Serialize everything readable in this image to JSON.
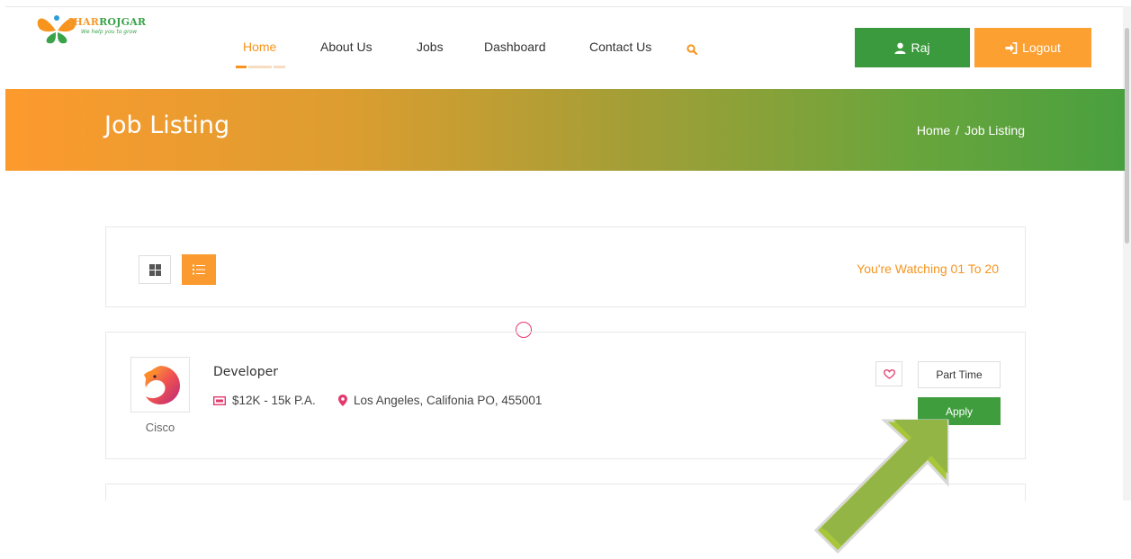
{
  "header": {
    "logo": {
      "part1": "JHAR",
      "part2": "ROJGAR",
      "tagline": "We help you to grow"
    },
    "nav": [
      {
        "label": "Home",
        "active": true
      },
      {
        "label": "About Us",
        "active": false
      },
      {
        "label": "Jobs",
        "active": false
      },
      {
        "label": "Dashboard",
        "active": false
      },
      {
        "label": "Contact Us",
        "active": false
      }
    ],
    "search_icon": "search-icon",
    "user_button": {
      "label": "Raj",
      "icon": "user-icon"
    },
    "logout_button": {
      "label": "Logout",
      "icon": "sign-in-icon"
    }
  },
  "banner": {
    "title": "Job Listing",
    "breadcrumb": [
      "Home",
      "/",
      "Job Listing"
    ]
  },
  "toolbar": {
    "watching_text": "You're Watching 01 To 20",
    "grid_view_icon": "grid-icon",
    "list_view_icon": "list-icon"
  },
  "jobs": [
    {
      "title": "Developer",
      "company": "Cisco",
      "salary": "$12K - 15k P.A.",
      "location": "Los Angeles, Califonia PO, 455001",
      "type": "Part Time",
      "apply_label": "Apply"
    }
  ],
  "colors": {
    "accent_orange": "#f7941d",
    "accent_green": "#3c9a3e",
    "pink": "#e23a6e"
  }
}
